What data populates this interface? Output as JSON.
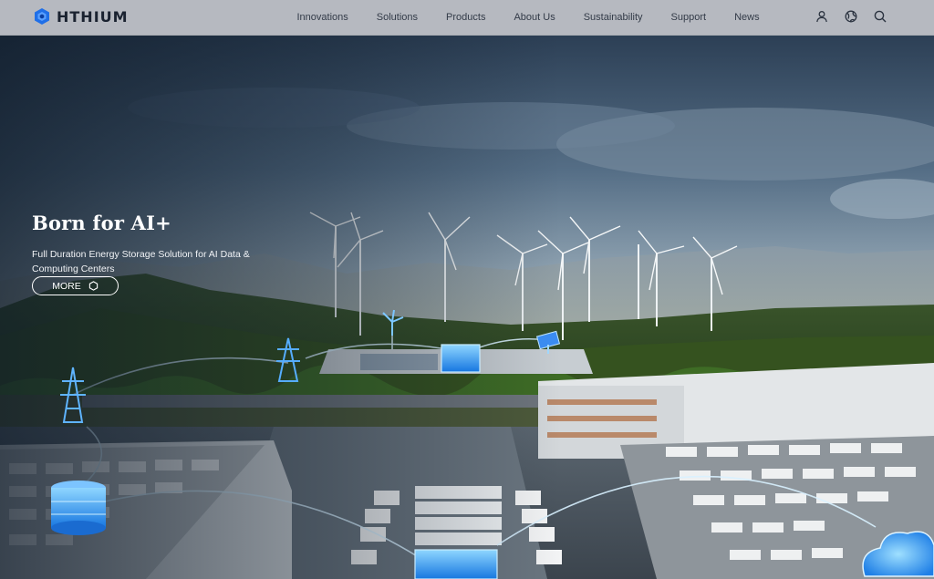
{
  "brand": {
    "name": "HTHIUM",
    "accent": "#1f6fe8"
  },
  "nav": {
    "items": [
      "Innovations",
      "Solutions",
      "Products",
      "About Us",
      "Sustainability",
      "Support",
      "News"
    ],
    "icons": [
      "user-icon",
      "globe-icon",
      "search-icon"
    ]
  },
  "hero": {
    "title": "Born for AI+",
    "subtitle": "Full Duration Energy Storage Solution for AI Data & Computing Centers",
    "button_label": "MORE",
    "button_icon": "hexagon-icon"
  }
}
